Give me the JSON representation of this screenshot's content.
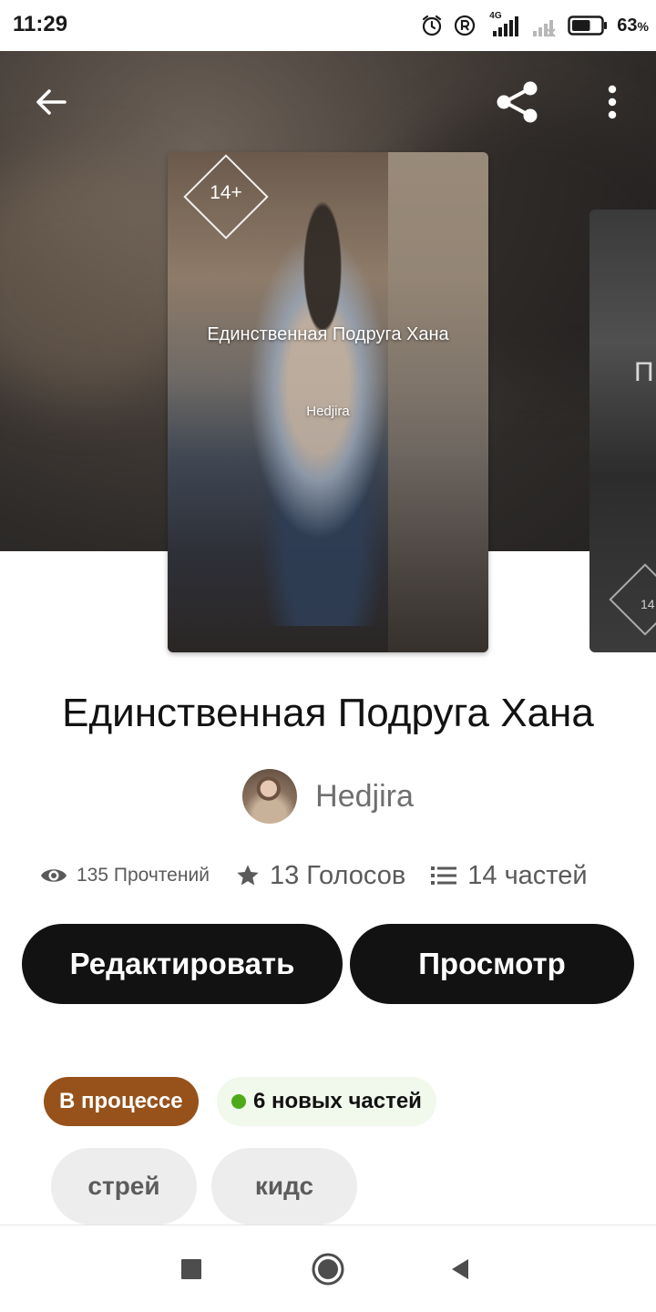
{
  "status_bar": {
    "time": "11:29",
    "network_label": "4G",
    "battery_percent": "63",
    "battery_percent_suffix": "%",
    "battery_level": 0.63,
    "icons": [
      "alarm-icon",
      "registered-icon",
      "signal-4g-icon",
      "signal-no-sim-icon",
      "battery-icon"
    ]
  },
  "header": {
    "back_icon": "arrow-left-icon",
    "share_icon": "share-icon",
    "more_icon": "more-vertical-icon"
  },
  "cover": {
    "age_badge": "14+",
    "title": "Единственная Подруга Хана",
    "author": "Hedjira"
  },
  "next_cover": {
    "title_fragment": "П",
    "age_badge_fragment": "14"
  },
  "story": {
    "title": "Единственная Подруга Хана",
    "author": "Hedjira"
  },
  "stats": {
    "reads": "135 Прочтений",
    "votes": "13 Голосов",
    "parts": "14 частей",
    "icons": [
      "eye-icon",
      "star-icon",
      "list-icon"
    ]
  },
  "actions": {
    "edit_label": "Редактировать",
    "view_label": "Просмотр"
  },
  "badges": {
    "status": "В процессе",
    "new_parts": "6 новых частей"
  },
  "tags": [
    "стрей",
    "кидс"
  ],
  "colors": {
    "primary_button": "#121212",
    "status_badge": "#96521a",
    "new_parts_bg": "#f1f8ec",
    "new_parts_dot": "#4eaa1a",
    "tag_bg": "#ededed"
  },
  "nav": {
    "icons": [
      "recent-apps-icon",
      "home-icon",
      "back-triangle-icon"
    ]
  }
}
